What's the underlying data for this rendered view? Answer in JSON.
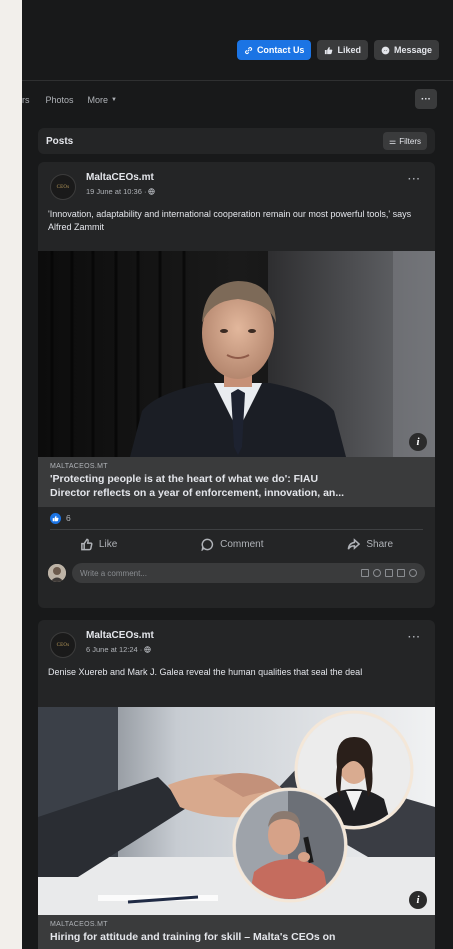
{
  "page": {
    "actions": {
      "contact": "Contact Us",
      "liked": "Liked",
      "message": "Message"
    },
    "tabs": {
      "fragment": "rs",
      "photos": "Photos",
      "more": "More",
      "menu_icon": "dots-icon"
    }
  },
  "posts_section": {
    "title": "Posts",
    "filters_label": "Filters"
  },
  "posts": [
    {
      "author": "MaltaCEOs.mt",
      "avatar_text": "CEOs",
      "date": "19 June at 10:36 ·",
      "text": "'Innovation, adaptability and international cooperation remain our most powerful tools,' says Alfred Zammit",
      "link_domain": "MALTACEOS.MT",
      "link_title_line1": "'Protecting people is at the heart of what we do': FIAU",
      "link_title_line2": "Director reflects on a year of enforcement, innovation, an...",
      "reaction_count": "6",
      "actions": {
        "like": "Like",
        "comment": "Comment",
        "share": "Share"
      },
      "comment_placeholder": "Write a comment..."
    },
    {
      "author": "MaltaCEOs.mt",
      "avatar_text": "CEOs",
      "date": "6 June at 12:24 ·",
      "text": "Denise Xuereb and Mark J. Galea reveal the human qualities that seal the deal",
      "link_domain": "MALTACEOS.MT",
      "link_title_line1": "Hiring for attitude and training for skill – Malta's CEOs on"
    }
  ],
  "colors": {
    "background": "#18191a",
    "card": "#242526",
    "accent": "#1b74e4",
    "secondary_button": "#3a3b3c",
    "text_primary": "#e4e6eb",
    "text_secondary": "#b0b3b8",
    "outer_bg": "#f2efeb"
  }
}
